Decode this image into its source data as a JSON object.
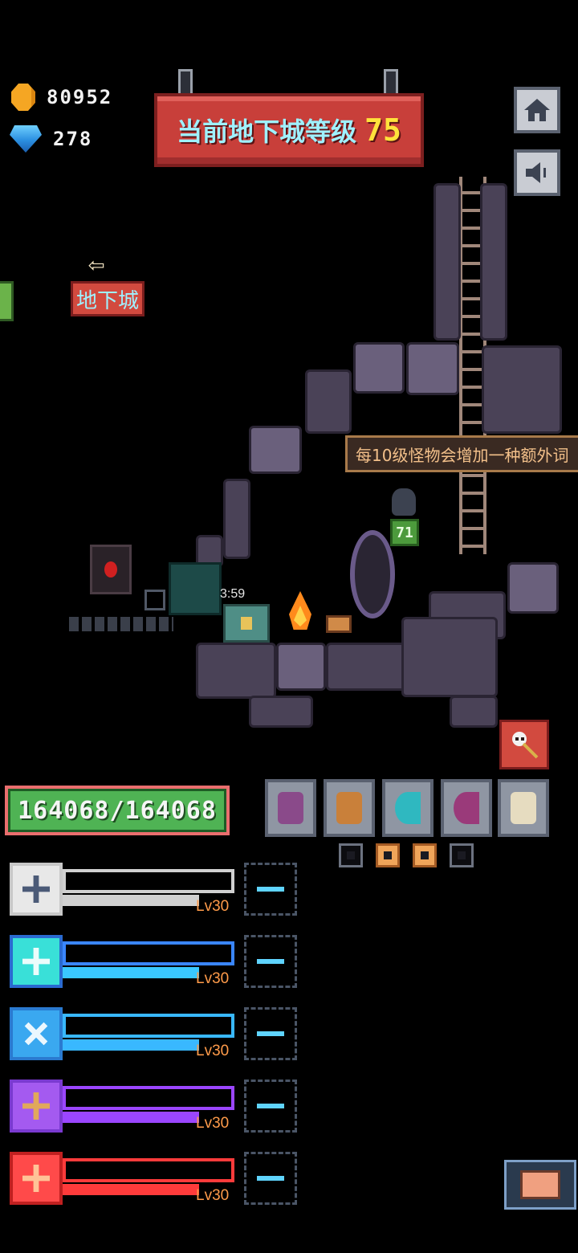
{
  "currency": {
    "gold": "80952",
    "gems": "278"
  },
  "header": {
    "title": "当前地下城等级",
    "level": "75"
  },
  "nav": {
    "dungeon_label": "地下城"
  },
  "scene": {
    "tooltip": "每10级怪物会增加一种额外词",
    "monster_level": "71",
    "chest_timer": "3:59"
  },
  "player": {
    "hp": "164068/164068"
  },
  "equipment": {
    "slots": [
      "shield-icon",
      "banner-icon",
      "bow-icon",
      "crossbow-icon",
      "skull-staff-icon"
    ]
  },
  "party": [
    {
      "level": "Lv30",
      "color": "#d9d9d9",
      "weapon": "mace-icon"
    },
    {
      "level": "Lv30",
      "color": "#3a86ff",
      "weapon": "hammer-icon"
    },
    {
      "level": "Lv30",
      "color": "#39b8ff",
      "weapon": "crossed-swords-icon"
    },
    {
      "level": "Lv30",
      "color": "#9b46ff",
      "weapon": "staff-icon"
    },
    {
      "level": "Lv30",
      "color": "#ff3b3b",
      "weapon": "axe-icon"
    }
  ]
}
